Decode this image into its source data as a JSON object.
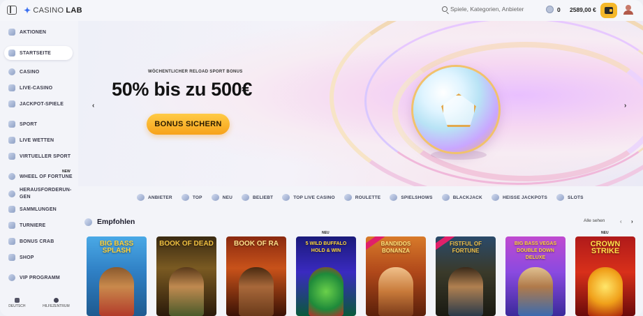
{
  "header": {
    "logo_casino": "CASINO",
    "logo_lab": "LAB",
    "search_placeholder": "Spiele, Kategorien, Anbieter",
    "chips": "0",
    "balance": "2589,00 €"
  },
  "sidebar": {
    "items": [
      {
        "label": "AKTIONEN"
      },
      {
        "label": "STARTSEITE"
      },
      {
        "label": "CASINO"
      },
      {
        "label": "LIVE-CASINO"
      },
      {
        "label": "JACKPOT-SPIELE"
      },
      {
        "label": "SPORT"
      },
      {
        "label": "LIVE WETTEN"
      },
      {
        "label": "VIRTUELLER SPORT"
      },
      {
        "label": "WHEEL OF FORTUNE"
      },
      {
        "label": "HERAUSFORDERUN-"
      },
      {
        "label": "GEN"
      },
      {
        "label": "SAMMLUNGEN"
      },
      {
        "label": "TURNIERE"
      },
      {
        "label": "BONUS CRAB"
      },
      {
        "label": "SHOP"
      },
      {
        "label": "VIP PROGRAMM"
      }
    ],
    "new_badge": "NEW",
    "footer": {
      "left": "DEUTSCH",
      "right": "HILFEZENTRUM"
    }
  },
  "hero": {
    "subtitle": "WÖCHENTLICHER RELOAD SPORT BONUS",
    "title": "50% bis zu 500€",
    "cta": "BONUS SICHERN",
    "prev": "‹",
    "next": "›"
  },
  "categories": [
    {
      "label": "ANBIETER"
    },
    {
      "label": "TOP"
    },
    {
      "label": "NEU"
    },
    {
      "label": "BELIEBT"
    },
    {
      "label": "TOP LIVE CASINO"
    },
    {
      "label": "ROULETTE"
    },
    {
      "label": "SPIELSHOWS"
    },
    {
      "label": "BLACKJACK"
    },
    {
      "label": "HEISSE JACKPOTS"
    },
    {
      "label": "SLOTS"
    }
  ],
  "featured": {
    "title": "Empfohlen",
    "see_all": "Alle sehen",
    "prev": "‹",
    "next": "›",
    "new_label": "NEU",
    "games": [
      {
        "title": "BIG BASS SPLASH"
      },
      {
        "title": "BOOK OF DEAD"
      },
      {
        "title": "BOOK OF RA"
      },
      {
        "title": "5 WILD BUFFALO HOLD & WIN"
      },
      {
        "title": "BANDIDOS BONANZA"
      },
      {
        "title": "FISTFUL OF FORTUNE"
      },
      {
        "title": "BIG BASS VEGAS DOUBLE DOWN DELUXE"
      },
      {
        "title": "CROWN STRIKE"
      }
    ]
  },
  "colors": {
    "accent": "#f7a21a",
    "brand_blue": "#3a6ff0",
    "text_dark": "#121212"
  }
}
